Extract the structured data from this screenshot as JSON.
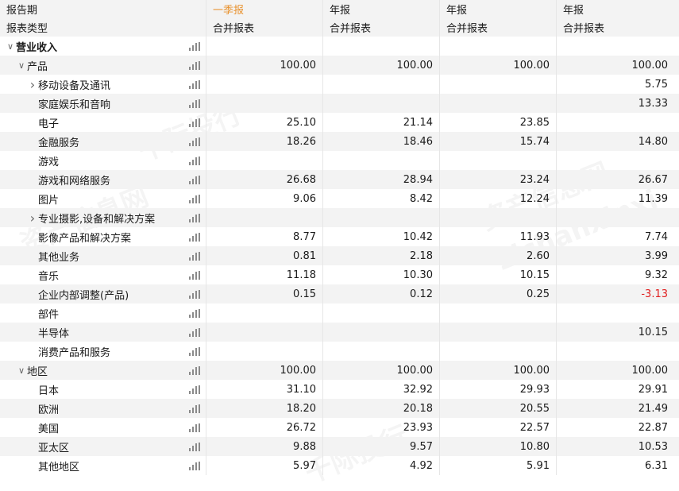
{
  "header": {
    "period_label": "报告期",
    "type_label": "报表类型",
    "periods": [
      "一季报",
      "年报",
      "年报",
      "年报"
    ],
    "types": [
      "合并报表",
      "合并报表",
      "合并报表",
      "合并报表"
    ]
  },
  "colors": {
    "accent": "#e8912d",
    "negative": "#e02020",
    "stripe": "#f3f3f3"
  },
  "rows": [
    {
      "label": "营业收入",
      "indent": 0,
      "chevron": "down",
      "bold": true,
      "values": [
        "",
        "",
        "",
        ""
      ]
    },
    {
      "label": "产品",
      "indent": 1,
      "chevron": "down",
      "values": [
        "100.00",
        "100.00",
        "100.00",
        "100.00"
      ]
    },
    {
      "label": "移动设备及通讯",
      "indent": 2,
      "chevron": "right",
      "values": [
        "",
        "",
        "",
        "5.75"
      ]
    },
    {
      "label": "家庭娱乐和音响",
      "indent": 2,
      "values": [
        "",
        "",
        "",
        "13.33"
      ]
    },
    {
      "label": "电子",
      "indent": 2,
      "values": [
        "25.10",
        "21.14",
        "23.85",
        ""
      ]
    },
    {
      "label": "金融服务",
      "indent": 2,
      "values": [
        "18.26",
        "18.46",
        "15.74",
        "14.80"
      ]
    },
    {
      "label": "游戏",
      "indent": 2,
      "values": [
        "",
        "",
        "",
        ""
      ]
    },
    {
      "label": "游戏和网络服务",
      "indent": 2,
      "values": [
        "26.68",
        "28.94",
        "23.24",
        "26.67"
      ]
    },
    {
      "label": "图片",
      "indent": 2,
      "values": [
        "9.06",
        "8.42",
        "12.24",
        "11.39"
      ]
    },
    {
      "label": "专业摄影,设备和解决方案",
      "indent": 2,
      "chevron": "right",
      "values": [
        "",
        "",
        "",
        ""
      ]
    },
    {
      "label": "影像产品和解决方案",
      "indent": 2,
      "values": [
        "8.77",
        "10.42",
        "11.93",
        "7.74"
      ]
    },
    {
      "label": "其他业务",
      "indent": 2,
      "values": [
        "0.81",
        "2.18",
        "2.60",
        "3.99"
      ]
    },
    {
      "label": "音乐",
      "indent": 2,
      "values": [
        "11.18",
        "10.30",
        "10.15",
        "9.32"
      ]
    },
    {
      "label": "企业内部调整(产品)",
      "indent": 2,
      "values": [
        "0.15",
        "0.12",
        "0.25",
        "-3.13"
      ]
    },
    {
      "label": "部件",
      "indent": 2,
      "values": [
        "",
        "",
        "",
        ""
      ]
    },
    {
      "label": "半导体",
      "indent": 2,
      "values": [
        "",
        "",
        "",
        "10.15"
      ]
    },
    {
      "label": "消费产品和服务",
      "indent": 2,
      "values": [
        "",
        "",
        "",
        ""
      ]
    },
    {
      "label": "地区",
      "indent": 1,
      "chevron": "down",
      "values": [
        "100.00",
        "100.00",
        "100.00",
        "100.00"
      ]
    },
    {
      "label": "日本",
      "indent": 2,
      "values": [
        "31.10",
        "32.92",
        "29.93",
        "29.91"
      ]
    },
    {
      "label": "欧洲",
      "indent": 2,
      "values": [
        "18.20",
        "20.18",
        "20.55",
        "21.49"
      ]
    },
    {
      "label": "美国",
      "indent": 2,
      "values": [
        "26.72",
        "23.93",
        "22.57",
        "22.87"
      ]
    },
    {
      "label": "亚太区",
      "indent": 2,
      "values": [
        "9.88",
        "9.57",
        "10.80",
        "10.53"
      ]
    },
    {
      "label": "其他地区",
      "indent": 2,
      "values": [
        "5.97",
        "4.92",
        "5.91",
        "6.31"
      ]
    }
  ]
}
